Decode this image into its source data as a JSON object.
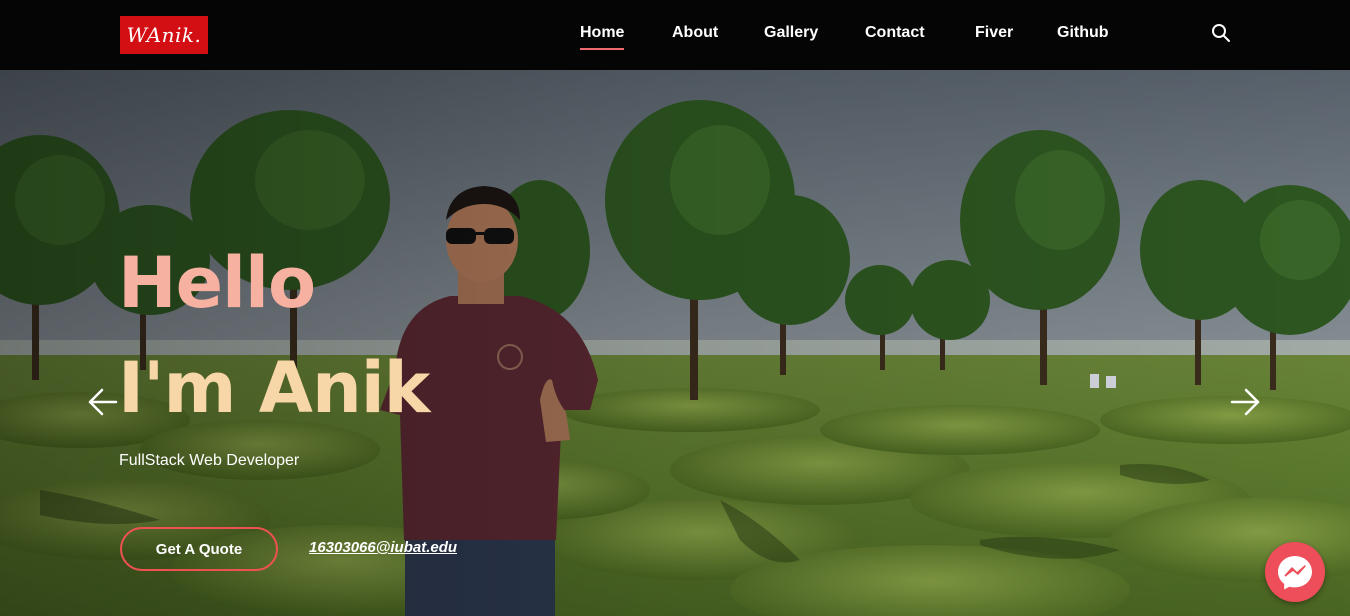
{
  "brand": {
    "logo_text": "WAnik."
  },
  "nav": {
    "items": [
      {
        "label": "Home",
        "active": true
      },
      {
        "label": "About",
        "active": false
      },
      {
        "label": "Gallery",
        "active": false
      },
      {
        "label": "Contact",
        "active": false
      },
      {
        "label": "Fiver",
        "active": false
      },
      {
        "label": "Github",
        "active": false
      }
    ],
    "search_icon": "search-icon"
  },
  "hero": {
    "greeting": "Hello",
    "name": "I'm Anik",
    "role": "FullStack Web Developer",
    "quote_button": "Get A Quote",
    "email": "16303066@iubat.edu",
    "prev_icon": "arrow-left-icon",
    "next_icon": "arrow-right-icon"
  },
  "chat": {
    "icon": "messenger-icon"
  },
  "colors": {
    "brand_red": "#d40f14",
    "accent": "#ef5151",
    "greeting": "#f7b1a1",
    "name": "#f7d7a8"
  }
}
